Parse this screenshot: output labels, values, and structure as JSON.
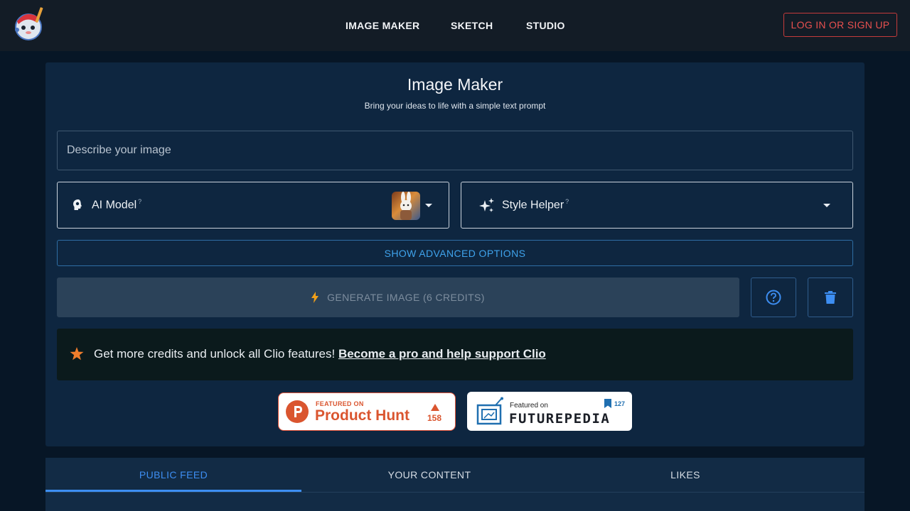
{
  "nav": {
    "items": [
      {
        "label": "IMAGE MAKER"
      },
      {
        "label": "SKETCH"
      },
      {
        "label": "STUDIO"
      }
    ],
    "login_label": "LOG IN OR SIGN UP"
  },
  "maker": {
    "title": "Image Maker",
    "subtitle": "Bring your ideas to life with a simple text prompt",
    "prompt_placeholder": "Describe your image",
    "ai_model_label": "AI Model",
    "style_helper_label": "Style Helper",
    "advanced_label": "SHOW ADVANCED OPTIONS",
    "generate_label": "GENERATE IMAGE (6 CREDITS)"
  },
  "promo": {
    "text": "Get more credits and unlock all Clio features!",
    "link": "Become a pro and help support Clio"
  },
  "badges": {
    "producthunt": {
      "featured": "FEATURED ON",
      "name": "Product Hunt",
      "count": "158"
    },
    "futurepedia": {
      "featured": "Featured on",
      "name": "FUTUREPEDIA",
      "count": "127"
    }
  },
  "tabs": [
    {
      "label": "PUBLIC FEED",
      "active": true
    },
    {
      "label": "YOUR CONTENT",
      "active": false
    },
    {
      "label": "LIKES",
      "active": false
    }
  ],
  "colors": {
    "accent": "#3d8ef2",
    "login_red": "#e8504f",
    "panel": "#0e2640",
    "producthunt": "#da552f"
  }
}
